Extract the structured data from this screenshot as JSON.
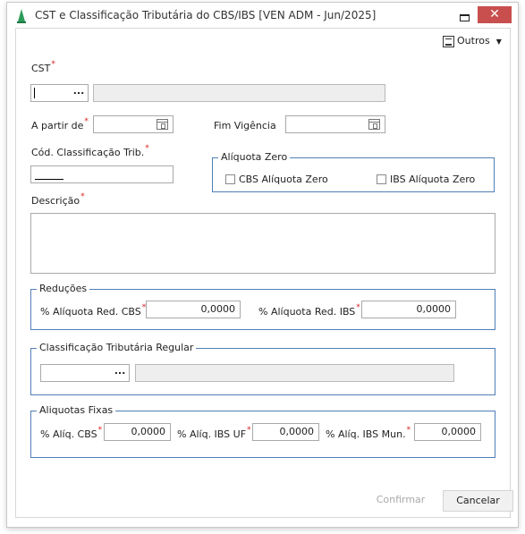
{
  "window": {
    "title": "CST e Classificação Tributária do CBS/IBS [VEN ADM - Jun/2025]",
    "close_glyph": "✕"
  },
  "toolbar": {
    "outros_label": "Outros"
  },
  "form": {
    "cst_label": "CST",
    "a_partir_de_label": "A partir de",
    "fim_vigencia_label": "Fim Vigência",
    "cod_classificacao_label": "Cód. Classificação Trib.",
    "descricao_label": "Descrição",
    "lookup_button": "...",
    "required_marker": "*"
  },
  "aliquota_zero": {
    "title": "Alíquota Zero",
    "cbs_label": "CBS Alíquota Zero",
    "ibs_label": "IBS Alíquota Zero",
    "cbs_checked": false,
    "ibs_checked": false
  },
  "reducoes": {
    "title": "Reduções",
    "cbs_label": "% Alíquota Red. CBS",
    "cbs_value": "0,0000",
    "ibs_label": "% Alíquota Red. IBS",
    "ibs_value": "0,0000"
  },
  "classificacao_regular": {
    "title": "Classificação Tributária Regular"
  },
  "aliquotas_fixas": {
    "title": "Aliquotas Fixas",
    "cbs_label": "% Alíq. CBS",
    "cbs_value": "0,0000",
    "ibs_uf_label": "% Alíq. IBS UF",
    "ibs_uf_value": "0,0000",
    "ibs_mun_label": "% Alíq. IBS Mun.",
    "ibs_mun_value": "0,0000"
  },
  "buttons": {
    "confirm_label": "Confirmar",
    "cancel_label": "Cancelar"
  },
  "colors": {
    "accent_border": "#4f7fb8",
    "close_button": "#c94f4f",
    "required": "#d51c1c",
    "disabled_text": "#aaaaaa"
  }
}
